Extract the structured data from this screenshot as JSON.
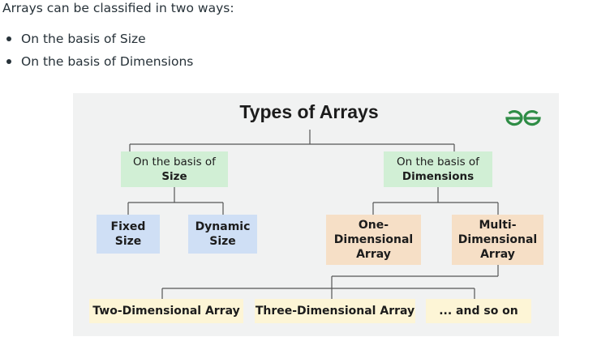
{
  "intro": "Arrays can be classified in two ways:",
  "bullets": [
    "On the basis of Size",
    "On the basis of Dimensions"
  ],
  "diagram": {
    "title": "Types of Arrays",
    "logo_icon": "geeksforgeeks-logo-icon",
    "size_group": {
      "line1": "On the basis of",
      "line2": "Size",
      "children": [
        {
          "line1": "Fixed",
          "line2": "Size"
        },
        {
          "line1": "Dynamic",
          "line2": "Size"
        }
      ]
    },
    "dimension_group": {
      "line1": "On the basis of",
      "line2": "Dimensions",
      "children": [
        {
          "line1": "One-",
          "line2": "Dimensional",
          "line3": "Array"
        },
        {
          "line1": "Multi-",
          "line2": "Dimensional",
          "line3": "Array"
        }
      ]
    },
    "multi_children": [
      "Two-Dimensional Array",
      "Three-Dimensional Array",
      "... and so on"
    ],
    "colors": {
      "background": "#f1f2f2",
      "green_box": "#d1efd5",
      "blue_box": "#cfdff5",
      "peach_box": "#f6dfc6",
      "yellow_box": "#fdf5d6",
      "logo": "#2f8d46"
    }
  }
}
